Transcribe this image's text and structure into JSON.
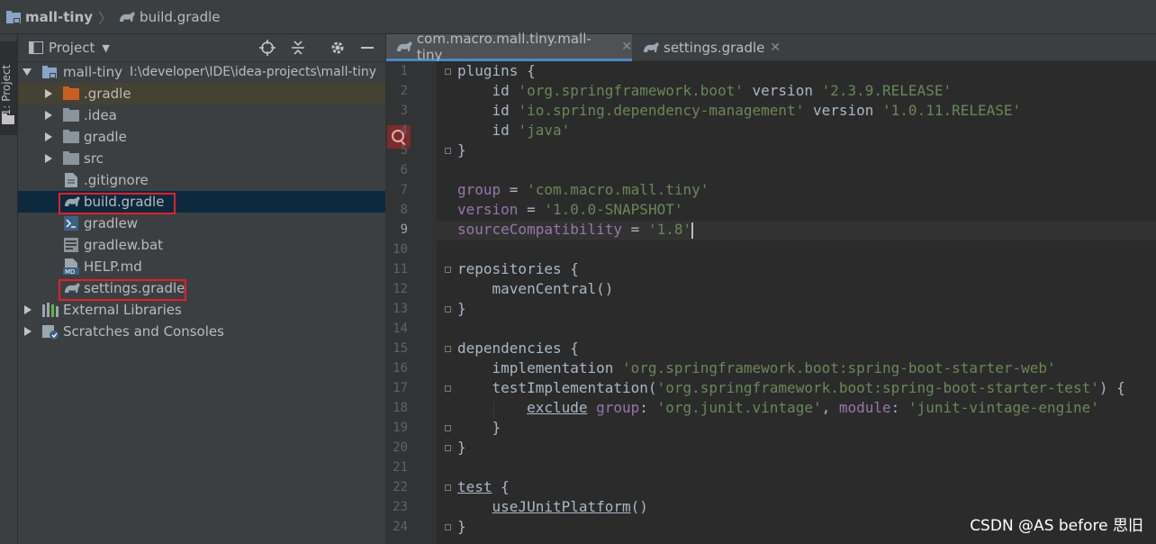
{
  "breadcrumb": {
    "project": "mall-tiny",
    "file": "build.gradle"
  },
  "left_strip": {
    "label": "1: Project"
  },
  "project_panel": {
    "title": "Project",
    "root": {
      "name": "mall-tiny",
      "path": "I:\\developer\\IDE\\idea-projects\\mall-tiny"
    },
    "items": [
      {
        "label": ".gradle"
      },
      {
        "label": ".idea"
      },
      {
        "label": "gradle"
      },
      {
        "label": "src"
      },
      {
        "label": ".gitignore"
      },
      {
        "label": "build.gradle"
      },
      {
        "label": "gradlew"
      },
      {
        "label": "gradlew.bat"
      },
      {
        "label": "HELP.md"
      },
      {
        "label": "settings.gradle"
      },
      {
        "label": "External Libraries"
      },
      {
        "label": "Scratches and Consoles"
      }
    ]
  },
  "tabs": [
    {
      "label": "com.macro.mall.tiny.mall-tiny",
      "active": true
    },
    {
      "label": "settings.gradle",
      "active": false
    }
  ],
  "editor": {
    "current_line": 9,
    "line_numbers": [
      "1",
      "2",
      "3",
      "4",
      "5",
      "6",
      "7",
      "8",
      "9",
      "10",
      "11",
      "12",
      "13",
      "14",
      "15",
      "16",
      "17",
      "18",
      "19",
      "20",
      "21",
      "22",
      "23",
      "24"
    ],
    "code": {
      "l1": "plugins {",
      "l2a": "    id ",
      "l2b": "'org.springframework.boot'",
      "l2c": " version ",
      "l2d": "'2.3.9.RELEASE'",
      "l3a": "    id ",
      "l3b": "'io.spring.dependency-management'",
      "l3c": " version ",
      "l3d": "'1.0.11.RELEASE'",
      "l4a": "    id ",
      "l4b": "'java'",
      "l5": "}",
      "l7a": "group",
      "l7b": " = ",
      "l7c": "'com.macro.mall.tiny'",
      "l8a": "version",
      "l8b": " = ",
      "l8c": "'1.0.0-SNAPSHOT'",
      "l9a": "sourceCompatibility",
      "l9b": " = ",
      "l9c": "'1.8'",
      "l11": "repositories {",
      "l12": "    mavenCentral()",
      "l13": "}",
      "l15": "dependencies {",
      "l16a": "    implementation ",
      "l16b": "'org.springframework.boot:spring-boot-starter-web'",
      "l17a": "    testImplementation(",
      "l17b": "'org.springframework.boot:spring-boot-starter-test'",
      "l17c": ") {",
      "l18a": "        ",
      "l18b": "exclude",
      "l18c": " group",
      "l18d": ": ",
      "l18e": "'org.junit.vintage'",
      "l18f": ", ",
      "l18g": "module",
      "l18h": ": ",
      "l18i": "'junit-vintage-engine'",
      "l19": "    }",
      "l20": "}",
      "l22a": "test",
      "l22b": " {",
      "l23a": "    ",
      "l23b": "useJUnitPlatform",
      "l23c": "()",
      "l24": "}"
    }
  },
  "watermark": "CSDN @AS before 思旧",
  "colors": {
    "accent": "#4a88c7",
    "highlight_box": "#e0202a",
    "string": "#6a8759",
    "property": "#9876aa"
  }
}
